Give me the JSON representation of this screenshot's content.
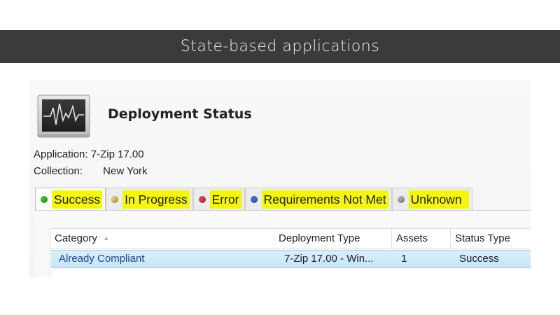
{
  "slide": {
    "title": "State-based applications"
  },
  "window": {
    "icon": "monitor-heartbeat-icon",
    "title": "Deployment Status",
    "application": {
      "label": "Application:",
      "value": "7-Zip 17.00"
    },
    "collection": {
      "label": "Collection:",
      "value": "New York"
    }
  },
  "tabs": [
    {
      "label": "Success",
      "dot_color": "#3fbf2e",
      "active": true
    },
    {
      "label": "In Progress",
      "dot_color": "#d9c56a"
    },
    {
      "label": "Error",
      "dot_color": "#d6444c"
    },
    {
      "label": "Requirements Not Met",
      "dot_color": "#3f6fcf"
    },
    {
      "label": "Unknown",
      "dot_color": "#a9a9a9"
    }
  ],
  "highlight_color": "#f4f60f",
  "table": {
    "columns": [
      "Category",
      "Deployment Type",
      "Assets",
      "Status Type"
    ],
    "rows": [
      [
        "Already Compliant",
        "7-Zip 17.00 - Win...",
        "1",
        "Success"
      ]
    ]
  }
}
